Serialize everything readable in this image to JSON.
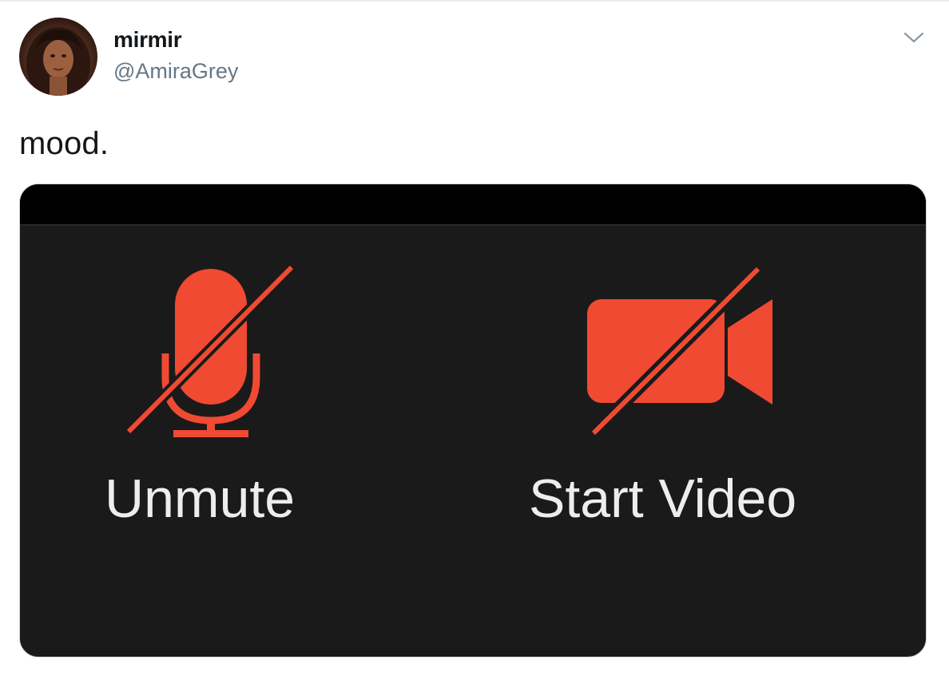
{
  "tweet": {
    "author": {
      "display_name": "mirmir",
      "handle": "@AmiraGrey"
    },
    "text": "mood.",
    "menu_icon": "chevron-down-icon"
  },
  "media": {
    "controls": [
      {
        "label": "Unmute",
        "icon": "microphone-muted-icon"
      },
      {
        "label": "Start Video",
        "icon": "video-camera-off-icon"
      }
    ],
    "colors": {
      "icon": "#f04a32",
      "label": "#ededed",
      "background": "#1a1a1a",
      "topbar": "#000000"
    }
  }
}
